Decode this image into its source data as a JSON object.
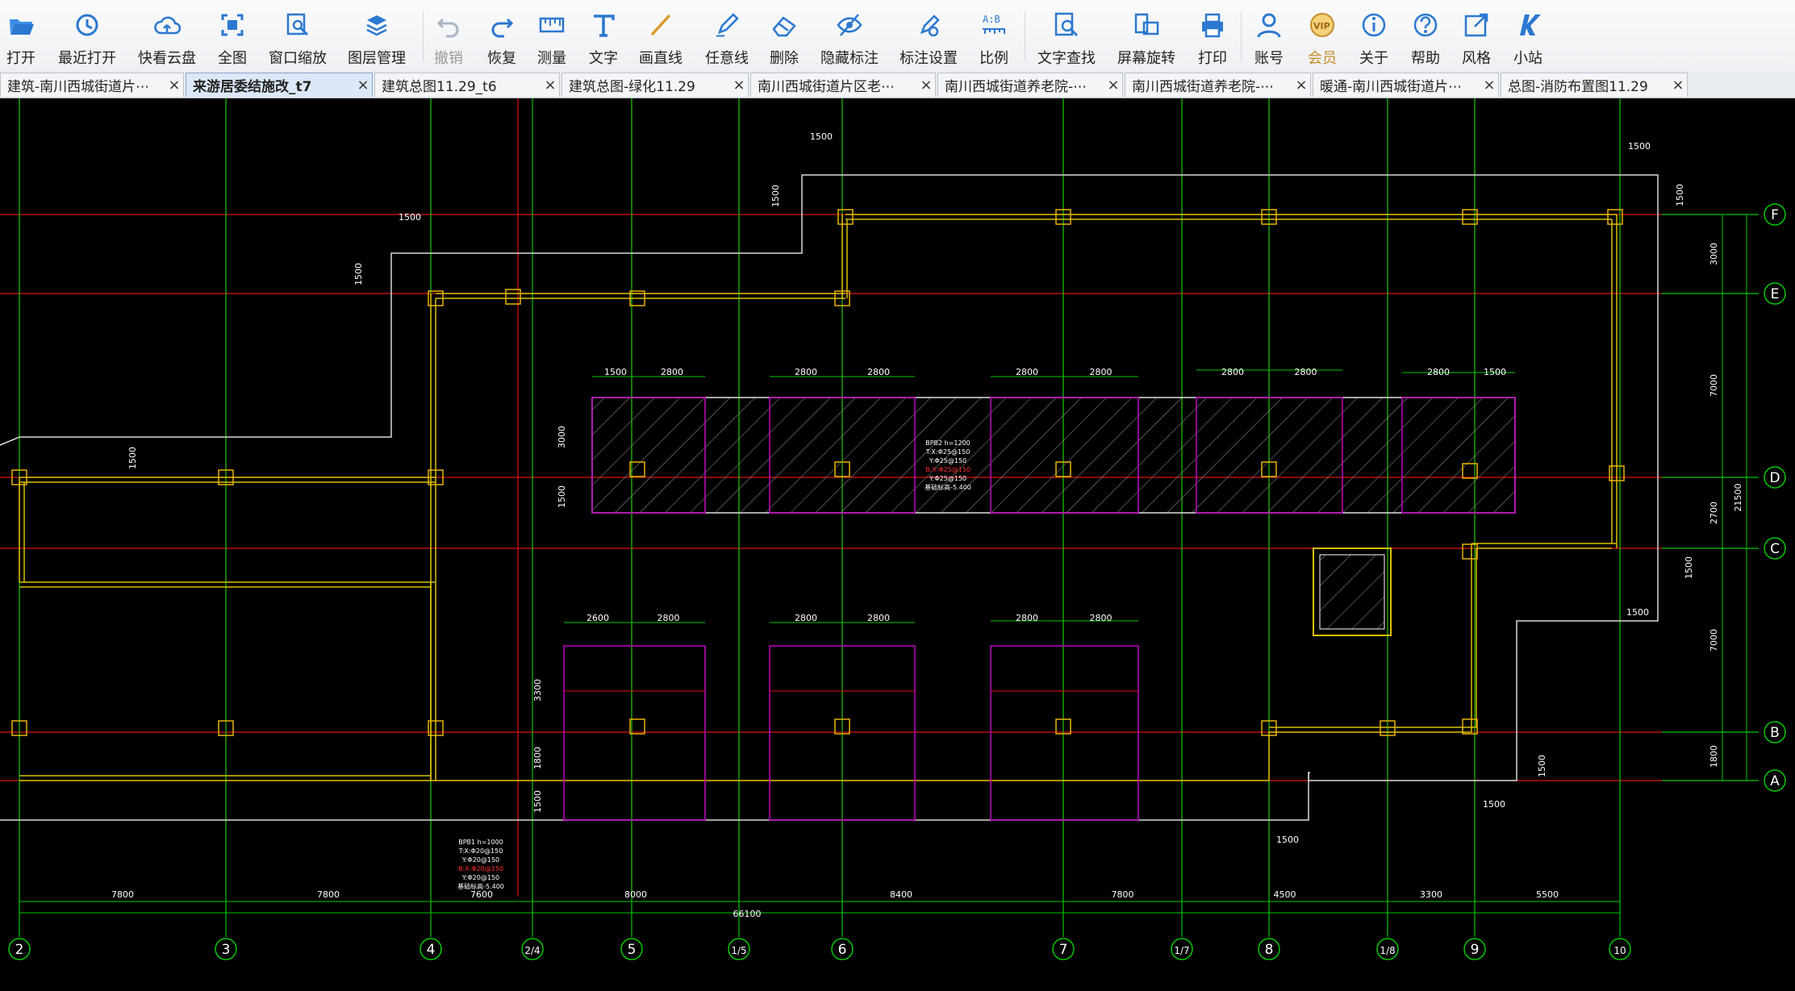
{
  "toolbar": {
    "items": [
      {
        "label": "打开",
        "icon": "folder-open-icon"
      },
      {
        "label": "最近打开",
        "icon": "recent-clock-icon"
      },
      {
        "label": "快看云盘",
        "icon": "cloud-icon"
      },
      {
        "label": "全图",
        "icon": "fit-all-icon"
      },
      {
        "label": "窗口缩放",
        "icon": "zoom-window-icon"
      },
      {
        "label": "图层管理",
        "icon": "layers-icon"
      },
      {
        "label": "撤销",
        "icon": "undo-icon",
        "disabled": true
      },
      {
        "label": "恢复",
        "icon": "redo-icon"
      },
      {
        "label": "测量",
        "icon": "measure-ruler-icon"
      },
      {
        "label": "文字",
        "icon": "text-T-icon"
      },
      {
        "label": "画直线",
        "icon": "line-icon"
      },
      {
        "label": "任意线",
        "icon": "pen-freehand-icon"
      },
      {
        "label": "删除",
        "icon": "eraser-icon"
      },
      {
        "label": "隐藏标注",
        "icon": "eye-hide-icon"
      },
      {
        "label": "标注设置",
        "icon": "annotation-settings-icon"
      },
      {
        "label": "比例",
        "icon": "scale-ab-icon"
      },
      {
        "label": "文字查找",
        "icon": "text-search-icon"
      },
      {
        "label": "屏幕旋转",
        "icon": "screen-rotate-icon"
      },
      {
        "label": "打印",
        "icon": "printer-icon"
      },
      {
        "label": "账号",
        "icon": "user-icon"
      },
      {
        "label": "会员",
        "icon": "vip-badge-icon"
      },
      {
        "label": "关于",
        "icon": "info-icon"
      },
      {
        "label": "帮助",
        "icon": "help-question-icon"
      },
      {
        "label": "风格",
        "icon": "style-expand-icon"
      },
      {
        "label": "小站",
        "icon": "k-logo-icon"
      }
    ]
  },
  "tabs": [
    {
      "label": "建筑-南川西城街道片⋯",
      "close": "×"
    },
    {
      "label": "来游居委结施改_t7",
      "close": "×",
      "active": true
    },
    {
      "label": "建筑总图11.29_t6",
      "close": "×"
    },
    {
      "label": "建筑总图-绿化11.29",
      "close": "×"
    },
    {
      "label": "南川西城街道片区老⋯",
      "close": "×"
    },
    {
      "label": "南川西城街道养老院-⋯",
      "close": "×"
    },
    {
      "label": "南川西城街道养老院-⋯",
      "close": "×"
    },
    {
      "label": "暖通-南川西城街道片⋯",
      "close": "×"
    },
    {
      "label": "总图-消防布置图11.29",
      "close": "×"
    }
  ],
  "drawing": {
    "axis_bottom": [
      "2",
      "3",
      "4",
      "2/4",
      "5",
      "1/5",
      "6",
      "7",
      "1/7",
      "8",
      "1/8",
      "9",
      "10"
    ],
    "axis_right": [
      "F",
      "E",
      "D",
      "C",
      "B",
      "A"
    ],
    "bottom_dims": [
      "7800",
      "7800",
      "7600",
      "8000",
      "8400",
      "7800",
      "4500",
      "3300",
      "5500"
    ],
    "total_dim": "66100",
    "right_dims": [
      "3000",
      "7000",
      "2700",
      "7000",
      "1800"
    ],
    "right_total": "21500",
    "top_dims_row1": [
      "1500",
      "2800",
      "2800",
      "2800",
      "2800",
      "2800",
      "2800",
      "2800",
      "2800",
      "1500"
    ],
    "top_dims_row2": [
      "2600",
      "2800",
      "2800",
      "2800",
      "2800",
      "2800"
    ],
    "misc_dims": [
      "1500",
      "1500",
      "1500",
      "1500",
      "1500",
      "1500",
      "1500",
      "1500",
      "1500",
      "1500",
      "1500",
      "1500",
      "3000",
      "1500",
      "3300",
      "1800",
      "1500"
    ],
    "pile_note": [
      "BPB1 h=1000",
      "T:X:Φ20@150",
      "Y:Φ20@150",
      "B:X:Φ20@150",
      "Y:Φ20@150",
      "基础标高-5.400"
    ],
    "slab_note": [
      "BPB2 h=1200",
      "T:X:Φ25@150",
      "Y:Φ25@150",
      "B:X:Φ25@150",
      "Y:Φ25@150",
      "基础标高-5.400"
    ],
    "colors": {
      "axis": "#00c800",
      "grid_red": "#e01010",
      "wall_yellow": "#d8c000",
      "magenta": "#c000c0",
      "white": "#ffffff"
    }
  }
}
